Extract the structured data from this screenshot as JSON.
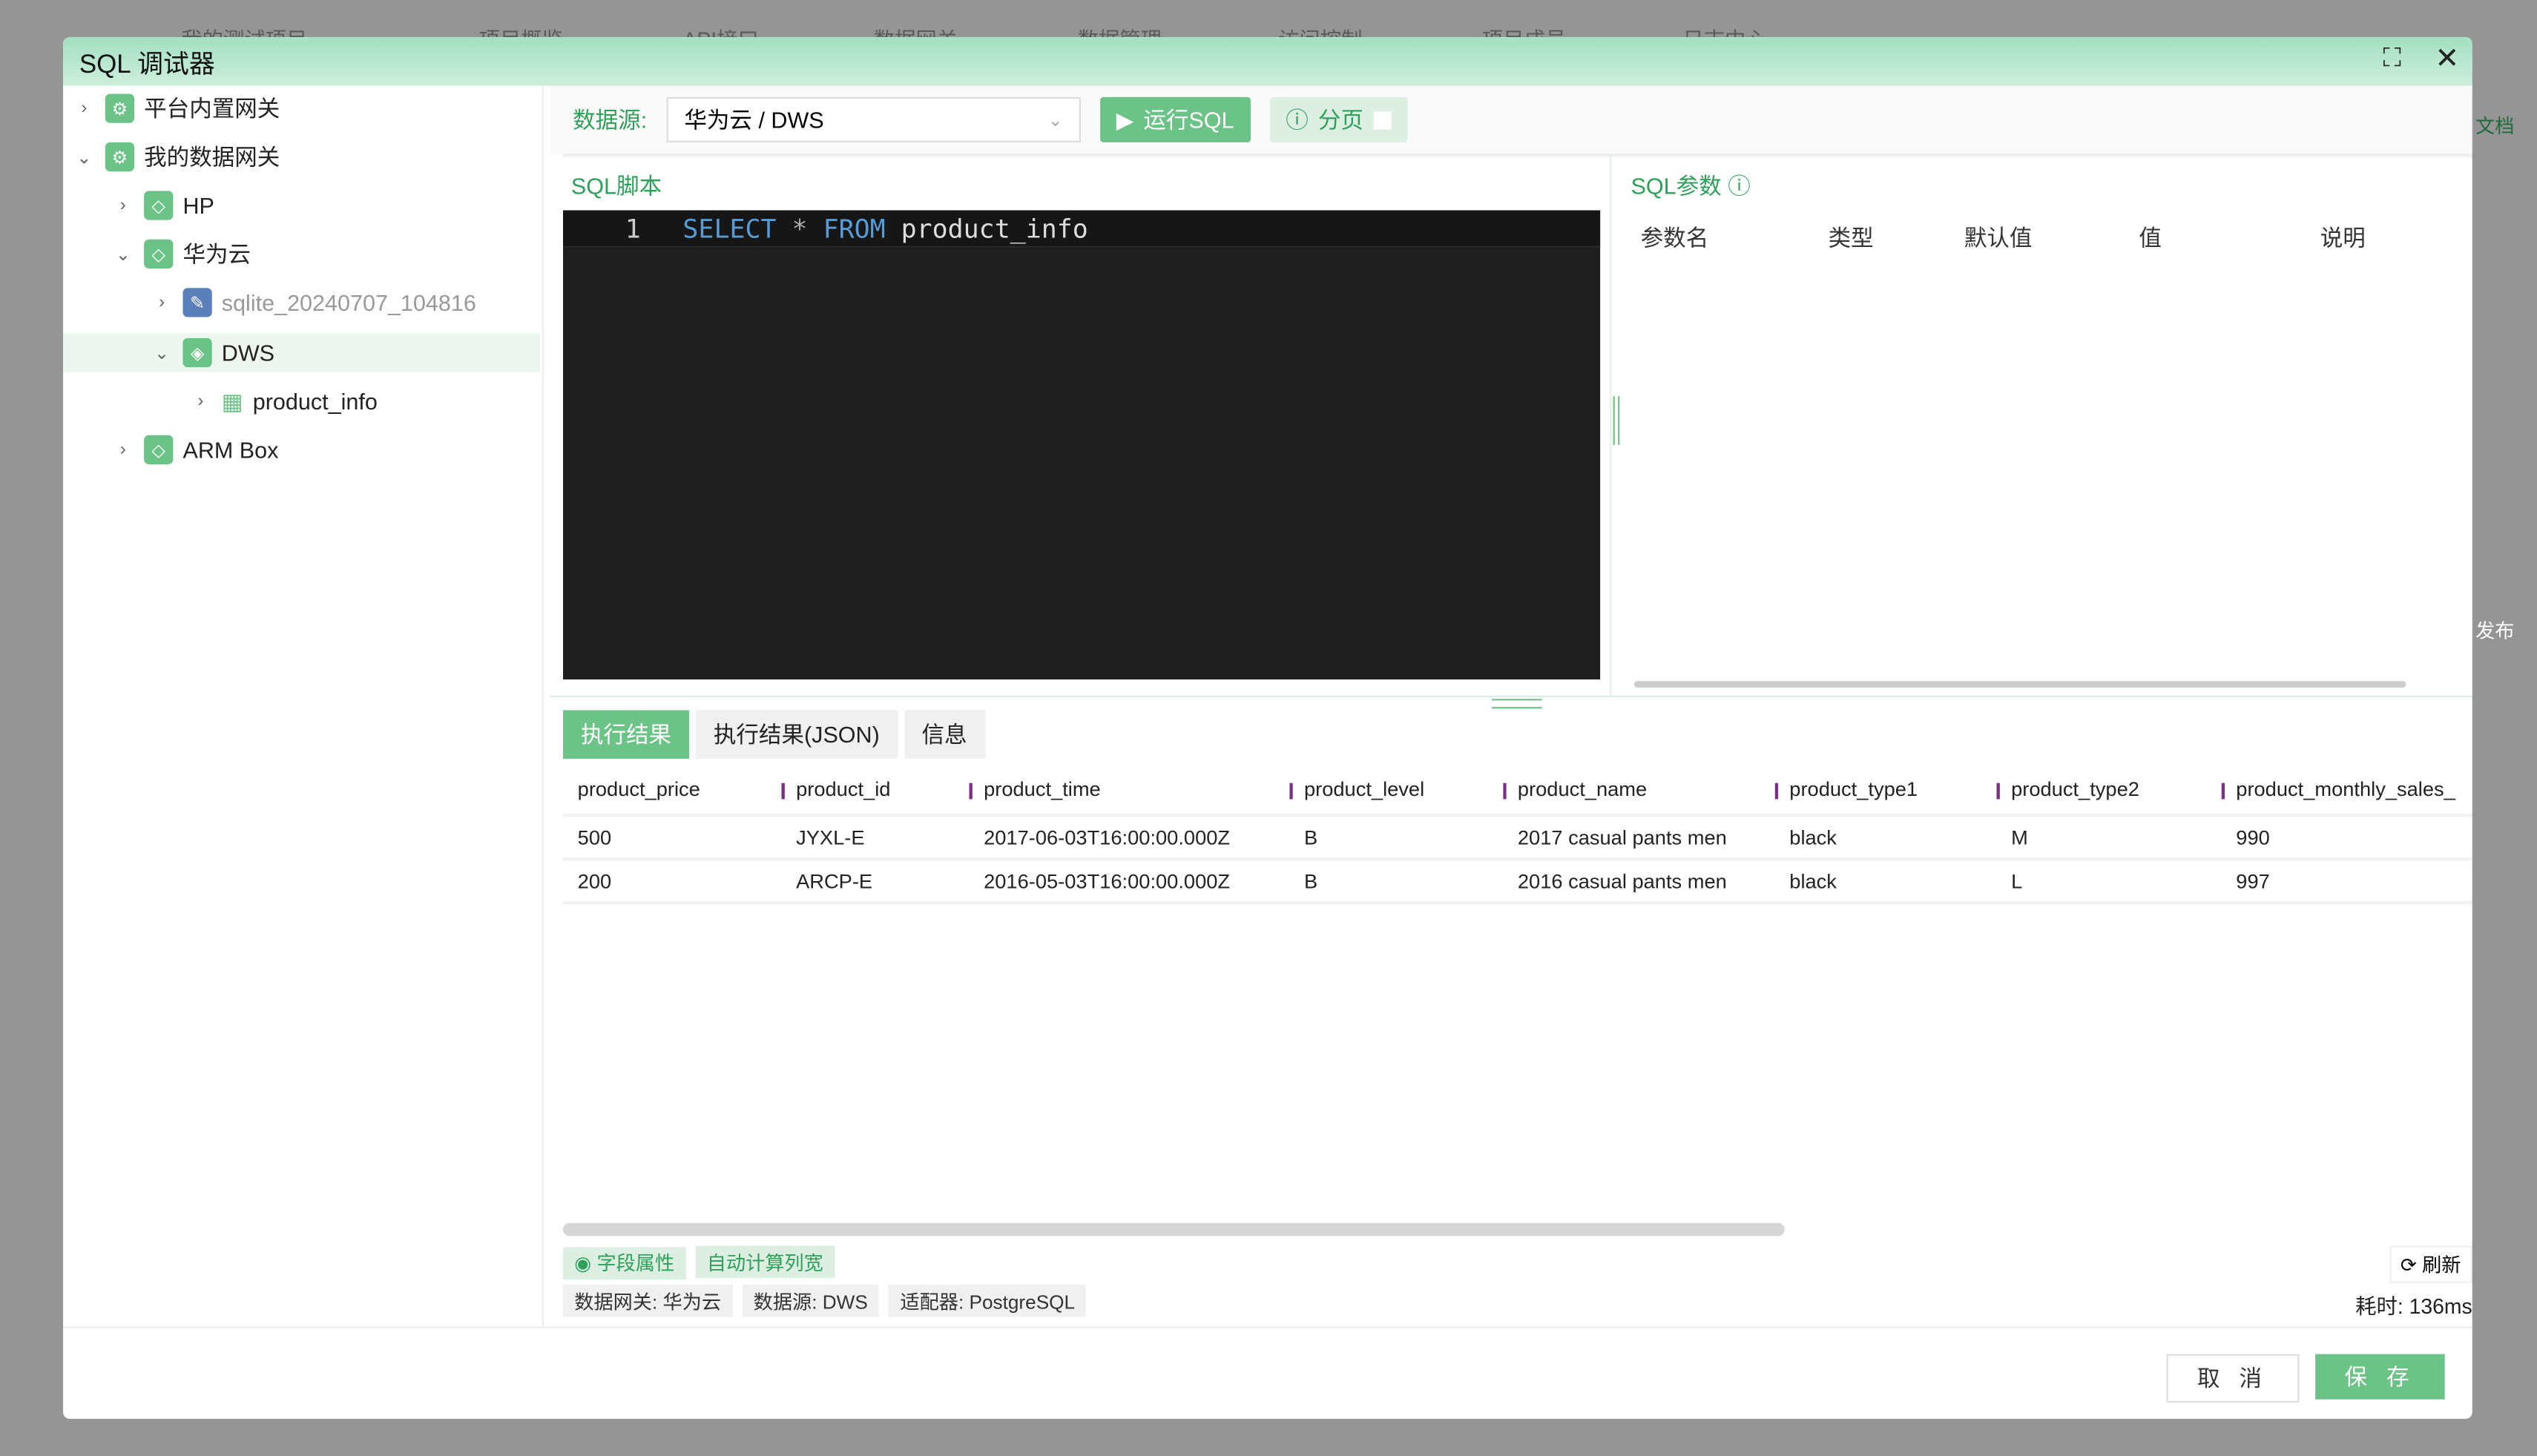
{
  "background_nav": {
    "project": "我的测试项目",
    "items": [
      "项目概览",
      "API接口",
      "数据网关",
      "数据管理",
      "访问控制",
      "项目成员",
      "日志中心"
    ],
    "right_fragments": [
      "文档",
      "发布"
    ]
  },
  "modal": {
    "title": "SQL 调试器"
  },
  "tree": [
    {
      "label": "平台内置网关",
      "level": 0,
      "expanded": false
    },
    {
      "label": "我的数据网关",
      "level": 0,
      "expanded": true
    },
    {
      "label": "HP",
      "level": 1,
      "expanded": false
    },
    {
      "label": "华为云",
      "level": 1,
      "expanded": true
    },
    {
      "label": "sqlite_20240707_104816",
      "level": 2,
      "expanded": false
    },
    {
      "label": "DWS",
      "level": 2,
      "expanded": true,
      "selected": true
    },
    {
      "label": "product_info",
      "level": 3,
      "expanded": false
    },
    {
      "label": "ARM Box",
      "level": 1,
      "expanded": false
    }
  ],
  "toolbar": {
    "datasource_label": "数据源:",
    "datasource_value": "华为云 / DWS",
    "run_label": "运行SQL",
    "paging_label": "分页",
    "paging_checked": false
  },
  "sql": {
    "title": "SQL脚本",
    "line_number": "1",
    "kw1": "SELECT",
    "star": "*",
    "kw2": "FROM",
    "table": "product_info"
  },
  "params": {
    "title": "SQL参数",
    "columns": [
      "参数名",
      "类型",
      "默认值",
      "值",
      "说明"
    ]
  },
  "result_tabs": [
    {
      "label": "执行结果",
      "active": true
    },
    {
      "label": "执行结果(JSON)"
    },
    {
      "label": "信息"
    }
  ],
  "results": {
    "columns": [
      "product_price",
      "product_id",
      "product_time",
      "product_level",
      "product_name",
      "product_type1",
      "product_type2",
      "product_monthly_sales_"
    ],
    "rows": [
      [
        "500",
        "JYXL-E",
        "2017-06-03T16:00:00.000Z",
        "B",
        "2017 casual pants men",
        "black",
        "M",
        "990"
      ],
      [
        "200",
        "ARCP-E",
        "2016-05-03T16:00:00.000Z",
        "B",
        "2016 casual pants men",
        "black",
        "L",
        "997"
      ]
    ]
  },
  "bottom": {
    "field_attr": "字段属性",
    "auto_width": "自动计算列宽",
    "gateway": "数据网关: 华为云",
    "datasource": "数据源: DWS",
    "adapter": "适配器: PostgreSQL",
    "refresh": "刷新",
    "elapsed": "耗时: 136ms"
  },
  "footer": {
    "cancel": "取 消",
    "save": "保 存"
  },
  "colors": {
    "accent": "#6cc387",
    "accent_text": "#2fa05a",
    "header_bar": "#7b2e86",
    "editor_bg": "#1e1e1e"
  }
}
